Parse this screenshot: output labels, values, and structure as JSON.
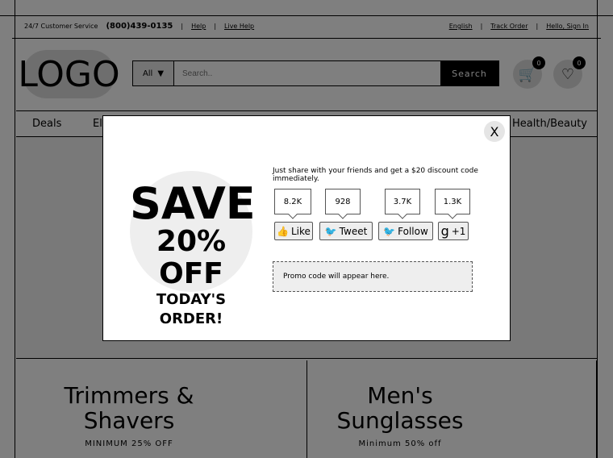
{
  "topbar": {
    "service": "24/7 Customer Service",
    "phone": "(800)439-0135",
    "help": "Help",
    "live_help": "Live Help",
    "language": "English",
    "track_order": "Track Order",
    "sign_in": "Hello, Sign In"
  },
  "header": {
    "logo": "LOGO",
    "category": "All",
    "search_placeholder": "Search..",
    "search_button": "Search",
    "cart_count": "0",
    "wishlist_count": "0"
  },
  "nav": {
    "items": [
      "Deals",
      "El",
      "Health/Beauty"
    ]
  },
  "promos": [
    {
      "title": "Trimmers & Shavers",
      "subtitle": "MINIMUM 25% OFF"
    },
    {
      "title": "Men's Sunglasses",
      "subtitle": "Minimum 50% off"
    }
  ],
  "modal": {
    "close": "X",
    "save_line1": "SAVE",
    "save_line2": "20% OFF",
    "save_line3": "TODAY'S ORDER!",
    "share_text": "Just share with your friends and get a $20 discount code immediately.",
    "social": [
      {
        "count": "8.2K",
        "label": "Like",
        "icon": "thumbs-up-icon"
      },
      {
        "count": "928",
        "label": "Tweet",
        "icon": "twitter-bird-icon"
      },
      {
        "count": "3.7K",
        "label": "Follow",
        "icon": "twitter-bird-icon"
      },
      {
        "count": "1.3K",
        "label": "+1",
        "icon": "google-g-icon"
      }
    ],
    "promo_placeholder": "Promo code will appear here."
  }
}
